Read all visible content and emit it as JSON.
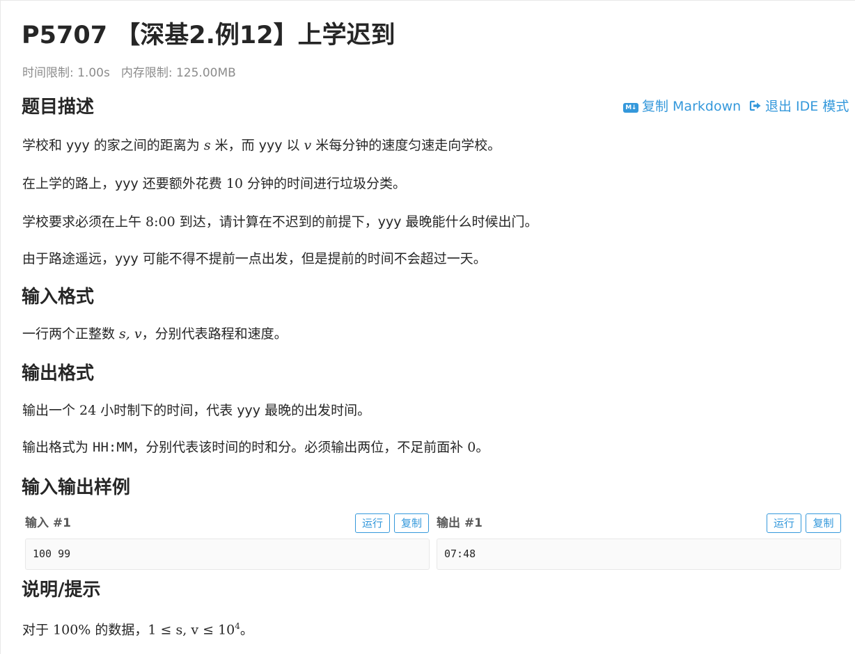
{
  "problem": {
    "title": "P5707 【深基2.例12】上学迟到",
    "time_limit": "时间限制: 1.00s",
    "memory_limit": "内存限制: 125.00MB"
  },
  "toolbar": {
    "copy_markdown_icon": "M↓",
    "copy_markdown": "复制 Markdown",
    "exit_ide": "退出 IDE 模式"
  },
  "description": {
    "heading": "题目描述",
    "p1": {
      "a": "学校和 yyy 的家之间的距离为 ",
      "s": "s",
      "b": " 米，而 yyy 以 ",
      "v": "v",
      "c": " 米每分钟的速度匀速走向学校。"
    },
    "p2": {
      "a": "在上学的路上，yyy 还要额外花费 ",
      "n": "10",
      "b": " 分钟的时间进行垃圾分类。"
    },
    "p3": {
      "a": "学校要求必须在上午 ",
      "t": "8:00",
      "b": " 到达，请计算在不迟到的前提下，yyy 最晚能什么时候出门。"
    },
    "p4": "由于路途遥远，yyy 可能不得不提前一点出发，但是提前的时间不会超过一天。"
  },
  "input_format": {
    "heading": "输入格式",
    "p1": {
      "a": "一行两个正整数 ",
      "vars": "s, v",
      "b": "，分别代表路程和速度。"
    }
  },
  "output_format": {
    "heading": "输出格式",
    "p1": {
      "a": "输出一个 ",
      "n": "24",
      "b": " 小时制下的时间，代表 yyy 最晚的出发时间。"
    },
    "p2": {
      "a": "输出格式为 ",
      "code": "HH:MM",
      "b": "，分别代表该时间的时和分。必须输出两位，不足前面补 ",
      "zero": "0",
      "c": "。"
    }
  },
  "samples": {
    "heading": "输入输出样例",
    "input_label": "输入 #1",
    "output_label": "输出 #1",
    "run_label": "运行",
    "copy_label": "复制",
    "input_value": "100 99",
    "output_value": "07:48"
  },
  "hint": {
    "heading": "说明/提示",
    "a": "对于 ",
    "pct": "100%",
    "b": " 的数据，",
    "expr": "1 ≤ s, v ≤ 10",
    "exp": "4",
    "c": "。"
  }
}
